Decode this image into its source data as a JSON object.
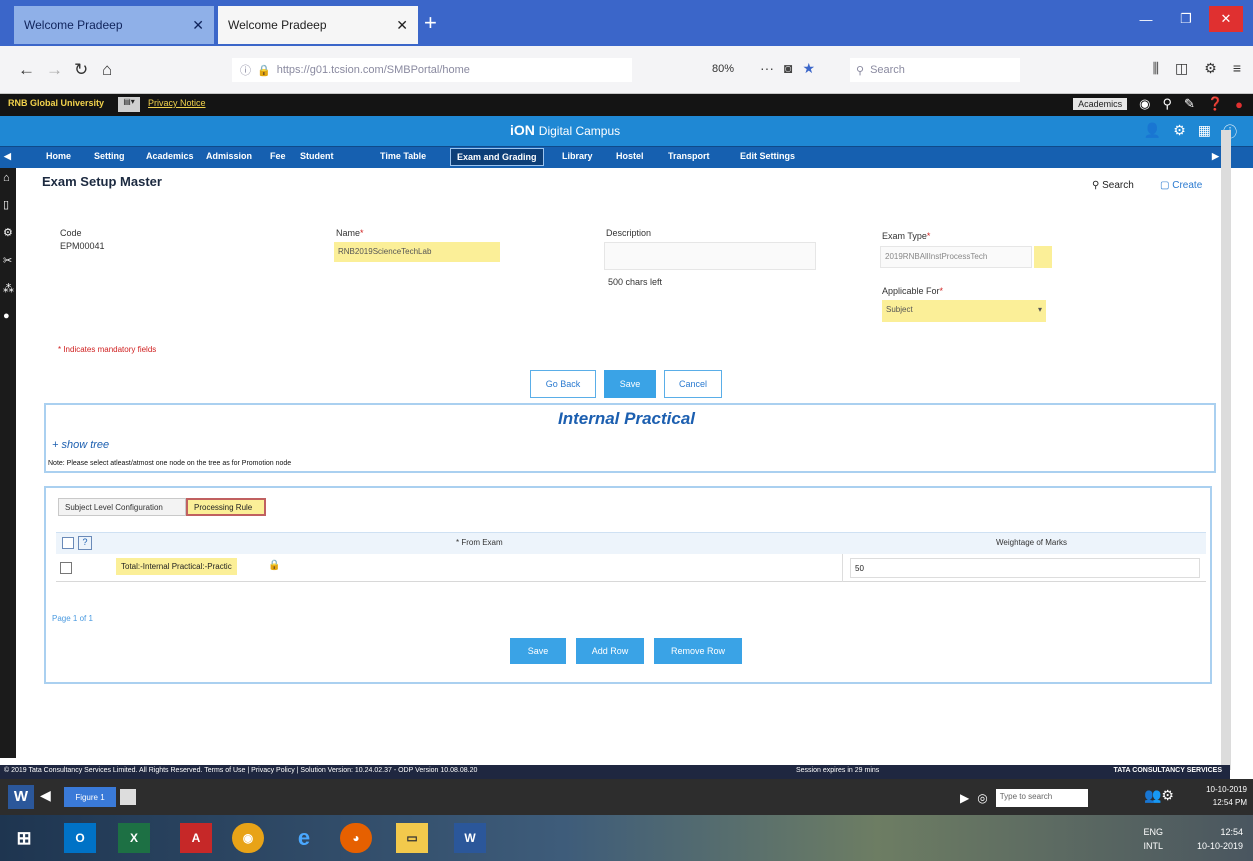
{
  "browser": {
    "tabs": [
      {
        "label": "Welcome Pradeep",
        "active": false
      },
      {
        "label": "Welcome Pradeep",
        "active": true
      }
    ],
    "new_tab": "+",
    "url": "https://g01.tcsion.com/SMBPortal/home",
    "zoom": "80%",
    "search_placeholder": "Search"
  },
  "header": {
    "university": "RNB Global University",
    "privacy_link": "Privacy Notice",
    "academic_selector": "Academics",
    "app_logo": "iON",
    "app_logo_sub": "Digital Campus"
  },
  "menu": {
    "items": [
      "Home",
      "Setting",
      "Academics",
      "Admission",
      "Fee",
      "Student",
      "Time Table",
      "Exam and Grading",
      "Library",
      "Hostel",
      "Transport",
      "Edit Settings"
    ],
    "active_index": 7
  },
  "page": {
    "title": "Exam Setup Master",
    "search_label": "Search",
    "create_label": "Create"
  },
  "form": {
    "code_label": "Code",
    "code_value": "EPM00041",
    "name_label": "Name",
    "name_value": "RNB2019ScienceTechLab",
    "description_label": "Description",
    "chars_left": "500 chars left",
    "exam_type_label": "Exam Type",
    "exam_type_value": "2019RNBAllInstProcessTech",
    "applicable_for_label": "Applicable For",
    "applicable_for_value": "Subject",
    "mandatory_note": "* Indicates mandatory fields"
  },
  "actions": {
    "go_back": "Go Back",
    "save": "Save",
    "cancel": "Cancel"
  },
  "practical": {
    "title": "Internal Practical",
    "show_tree": "+ show tree",
    "note": "Note: Please select atleast/atmost one node on the tree as for Promotion node"
  },
  "config": {
    "tabs": [
      "Subject Level Configuration",
      "Processing Rule"
    ],
    "active_tab": 1,
    "columns": [
      "* From Exam",
      "Weightage of Marks"
    ],
    "rows": [
      {
        "from_exam": "Total:-Internal Practical:-Practic",
        "weightage": "50"
      }
    ],
    "page_info": "Page 1 of 1",
    "buttons": [
      "Save",
      "Add Row",
      "Remove Row"
    ]
  },
  "footer": {
    "copyright": "© 2019 Tata Consultancy Services Limited. All Rights Reserved.   Terms of Use | Privacy Policy | Solution Version: 10.24.02.37 - ODP Version 10.08.08.20",
    "session": "Session expires in 29 mins",
    "brand": "TATA CONSULTANCY SERVICES"
  },
  "word_bar": {
    "figure_label": "Figure 1",
    "type_placeholder": "Type to search",
    "date": "10-10-2019",
    "time": "12:54 PM"
  },
  "taskbar": {
    "lang_line1": "ENG",
    "lang_line2": "INTL",
    "time": "12:54",
    "date": "10-10-2019"
  },
  "colors": {
    "app_blue": "#1f88d4",
    "menu_blue": "#1660b0",
    "highlight_yellow": "#fbef98",
    "button_blue": "#3aa3e6"
  }
}
